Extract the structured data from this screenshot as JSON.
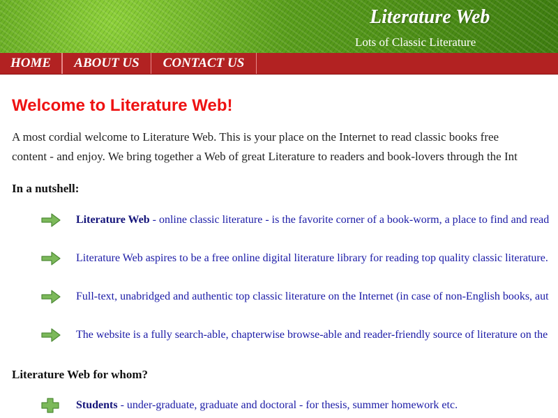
{
  "header": {
    "title": "Literature Web",
    "tagline": "Lots of Classic Literature"
  },
  "nav": {
    "home": "HOME",
    "about": "ABOUT US",
    "contact": "CONTACT US"
  },
  "main": {
    "title": "Welcome to Literature Web!",
    "intro_line1": "A most cordial welcome to Literature Web. This is your place on the Internet to read classic books free",
    "intro_line2": "content - and enjoy. We bring together a Web of great Literature to readers and book-lovers through the Int",
    "nutshell_heading": "In a nutshell:",
    "nutshell_items": [
      {
        "bold": "Literature Web",
        "text": " - online classic literature - is the favorite corner of a book-worm, a place to find and read"
      },
      {
        "bold": "",
        "text": "Literature Web aspires to be a free online digital literature library for reading top quality classic literature."
      },
      {
        "bold": "",
        "text": "Full-text, unabridged and authentic top classic literature on the Internet (in case of non-English books, aut"
      },
      {
        "bold": "",
        "text": "The website is a fully search-able, chapterwise browse-able and reader-friendly source of literature on the"
      }
    ],
    "forwhom_heading": "Literature Web for whom?",
    "forwhom_items": [
      {
        "bold": "Students",
        "text": " - under-graduate, graduate and doctoral - for thesis, summer homework etc."
      }
    ]
  },
  "icons": {
    "arrow": "arrow-right-icon",
    "plus": "plus-icon"
  },
  "colors": {
    "nav_bg": "#b22222",
    "title_red": "#ee1111",
    "link_blue": "#1a1aa6",
    "icon_green": "#6aa84f"
  }
}
